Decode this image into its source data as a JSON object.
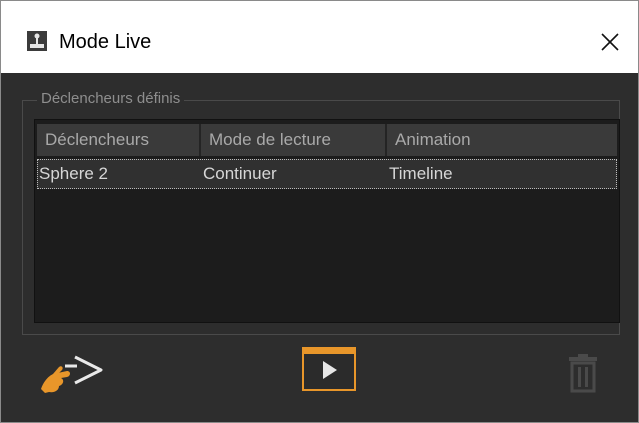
{
  "window": {
    "title": "Mode Live"
  },
  "icons": {
    "app": "joystick-icon",
    "close": "close-icon",
    "trigger": "hand-pointer-icon",
    "play": "play-icon",
    "delete": "trash-icon"
  },
  "colors": {
    "accent": "#e8962a",
    "panel": "#2d2d2d",
    "list_bg": "#1c1c1c",
    "header_bg": "#3a3a3a",
    "muted": "#8e8e8e"
  },
  "group": {
    "label": "Déclencheurs définis"
  },
  "table": {
    "columns": [
      "Déclencheurs",
      "Mode de lecture",
      "Animation"
    ],
    "rows": [
      [
        "Sphere 2",
        "Continuer",
        "Timeline"
      ]
    ]
  }
}
